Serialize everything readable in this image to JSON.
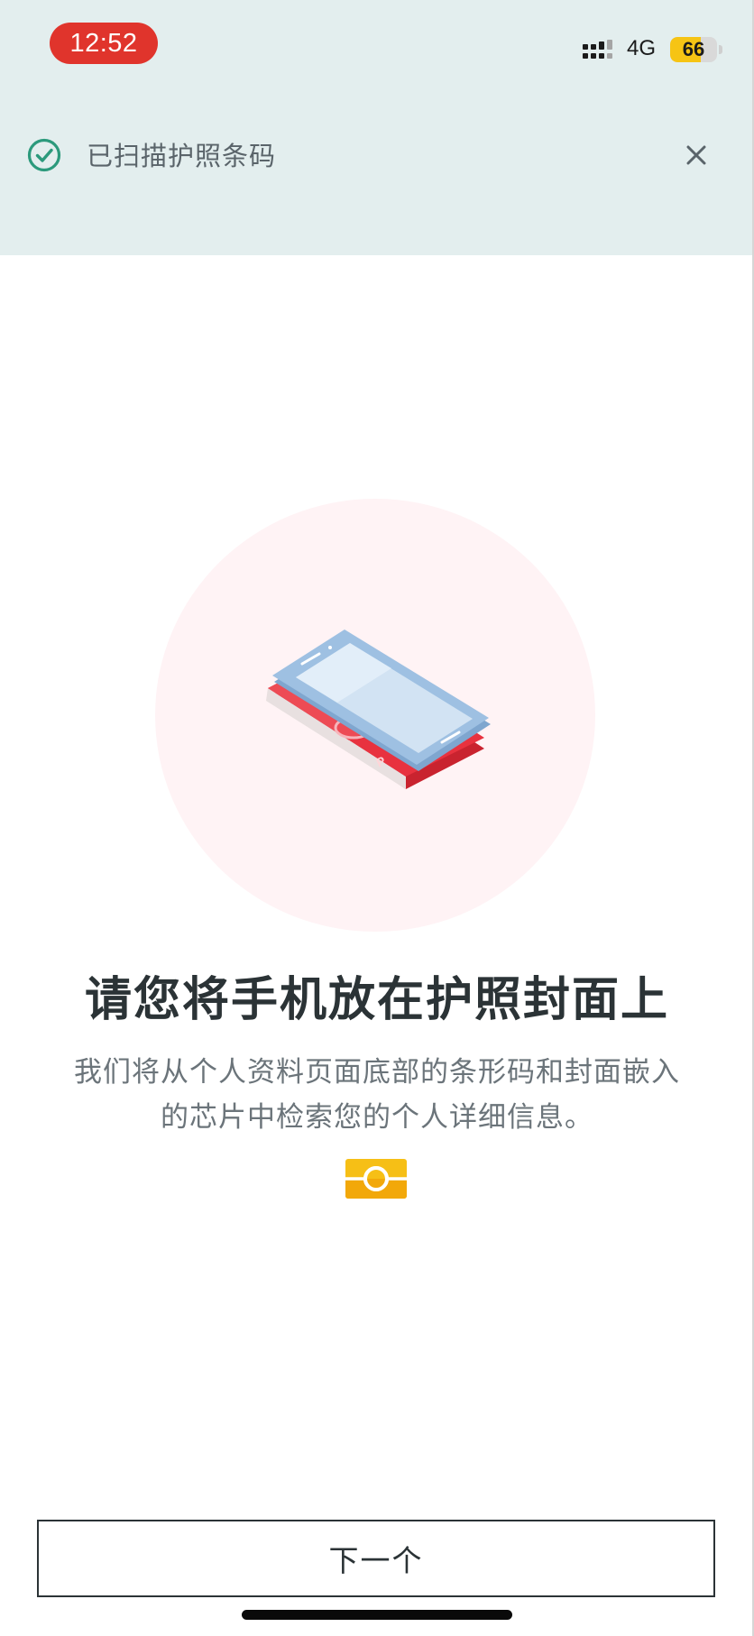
{
  "status_bar": {
    "time": "12:52",
    "network": "4G",
    "battery_level": "66",
    "battery_fraction": 0.66,
    "battery_color": "#f6c414",
    "time_pill_color": "#e0342c"
  },
  "notice": {
    "icon": "check-circle-icon",
    "text": "已扫描护照条码",
    "close_icon": "close-icon",
    "accent_color": "#2c9a7c"
  },
  "main": {
    "illustration": "phone-on-passport-illustration",
    "title": "请您将手机放在护照封面上",
    "description_line1": "我们将从个人资料页面底部的条形码和封面嵌入",
    "description_line2": "的芯片中检索您的个人详细信息。",
    "chip_icon": "passport-chip-icon",
    "chip_color": "#f6bf16"
  },
  "footer": {
    "next_button_label": "下一个"
  }
}
